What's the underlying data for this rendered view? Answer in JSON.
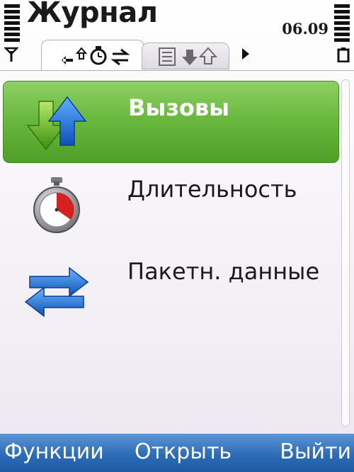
{
  "status": {
    "title": "Журнал",
    "time": "06.09",
    "icons": [
      "signal-strength-icon",
      "antenna-icon",
      "battery-level-icon",
      "battery-icon"
    ]
  },
  "tabs": [
    {
      "name": "calls-tab",
      "icons": [
        "call-arrows-icon",
        "timer-icon",
        "transfer-arrows-icon"
      ],
      "selected": true
    },
    {
      "name": "packet-tab",
      "icons": [
        "list-icon",
        "call-arrows-icon"
      ],
      "selected": false
    }
  ],
  "list": {
    "items": [
      {
        "label": "Вызовы",
        "icon": "calls-arrows-icon",
        "selected": true
      },
      {
        "label": "Длительность",
        "icon": "stopwatch-icon",
        "selected": false
      },
      {
        "label": "Пакетн. данные",
        "icon": "data-transfer-icon",
        "selected": false
      }
    ]
  },
  "softkeys": {
    "left": "Функции",
    "middle": "Открыть",
    "right": "Выйти"
  },
  "colors": {
    "highlight": "#6ab93f",
    "softkey_bar": "#2c6cb8",
    "accent_blue": "#1e63c8"
  }
}
